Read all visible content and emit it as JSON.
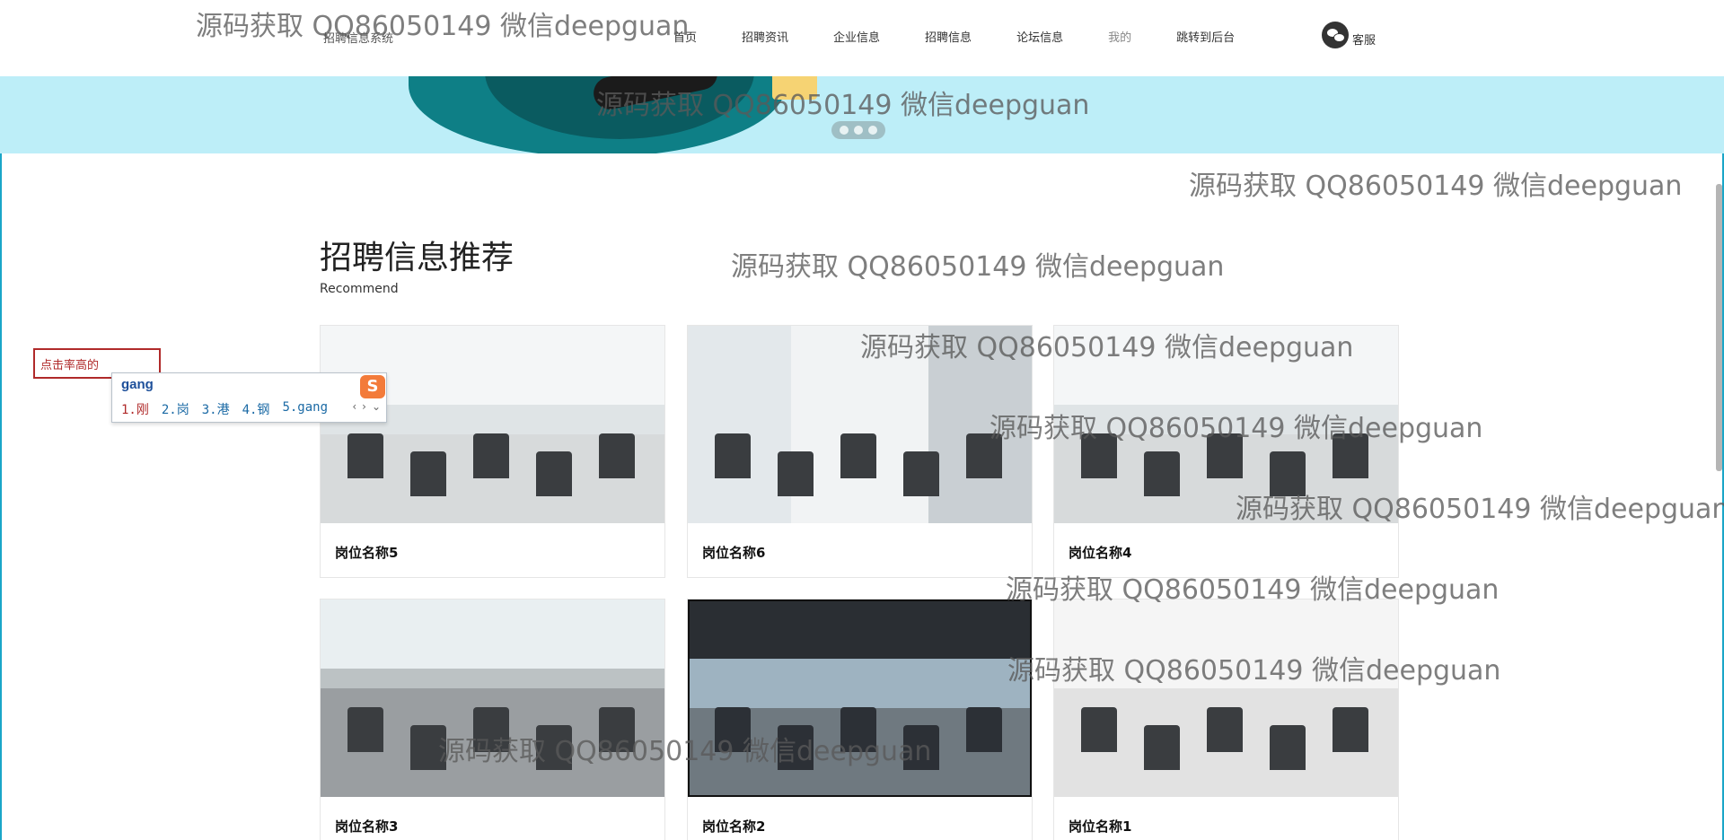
{
  "header": {
    "brand": "招聘信息系统",
    "nav": [
      {
        "label": "首页",
        "muted": false
      },
      {
        "label": "招聘资讯",
        "muted": false
      },
      {
        "label": "企业信息",
        "muted": false
      },
      {
        "label": "招聘信息",
        "muted": false
      },
      {
        "label": "论坛信息",
        "muted": false
      },
      {
        "label": "我的",
        "muted": true
      },
      {
        "label": "跳转到后台",
        "muted": false
      }
    ],
    "service_label": "客服"
  },
  "banner": {
    "dot_count": 3
  },
  "section": {
    "title": "招聘信息推荐",
    "subtitle": "Recommend"
  },
  "cards": [
    {
      "name": "岗位名称5",
      "image": "office-a"
    },
    {
      "name": "岗位名称6",
      "image": "office-b"
    },
    {
      "name": "岗位名称4",
      "image": "office-a"
    },
    {
      "name": "岗位名称3",
      "image": "office-c"
    },
    {
      "name": "岗位名称2",
      "image": "office-d"
    },
    {
      "name": "岗位名称1",
      "image": "office-e"
    }
  ],
  "search": {
    "value": "点击率高的"
  },
  "ime": {
    "pinyin": "gang",
    "logo": "S",
    "candidates": [
      "1.刚",
      "2.岗",
      "3.港",
      "4.钢",
      "5.gang"
    ]
  },
  "watermark": "源码获取 QQ86050149 微信deepguan"
}
